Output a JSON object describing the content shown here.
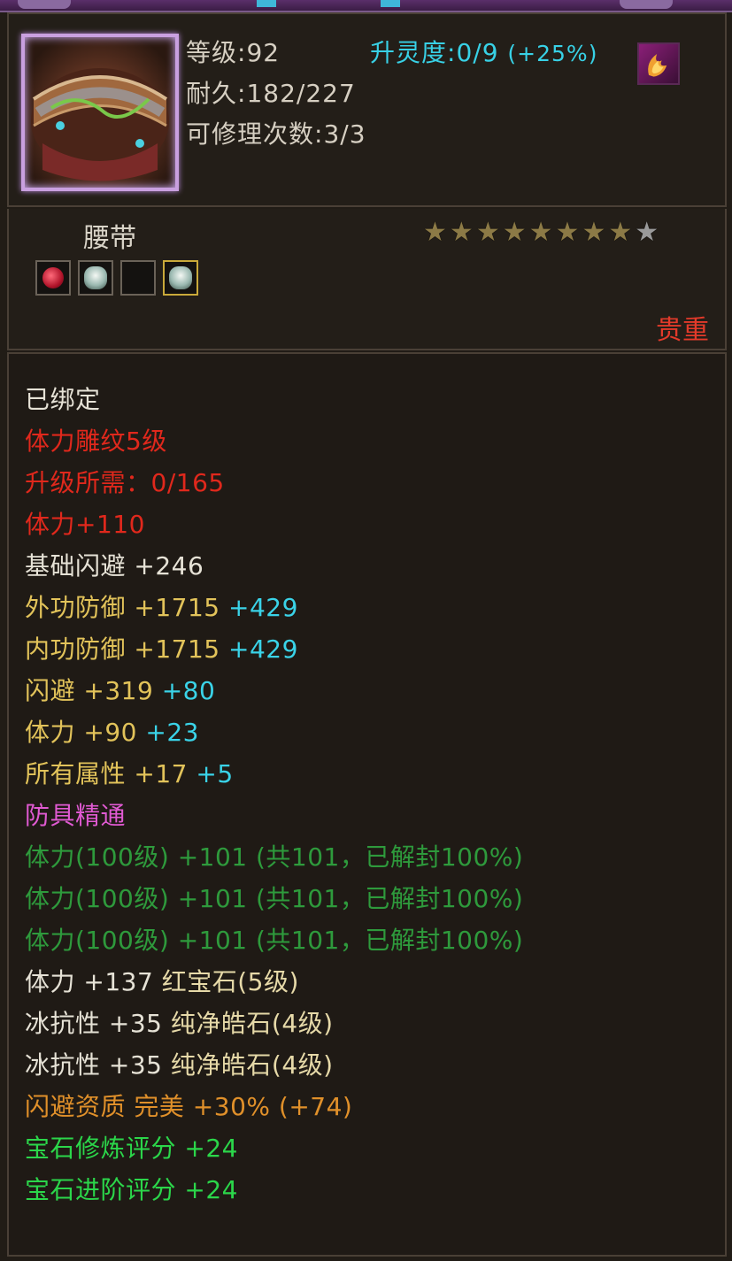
{
  "header": {
    "level_label": "等级",
    "level_value": ":92",
    "soul_label": "升灵度",
    "soul_value": ":0/9",
    "soul_bonus": "(+25%)",
    "durability_label": "耐久",
    "durability_value": ":182/227",
    "repair_label": "可修理次数",
    "repair_value": ":3/3"
  },
  "item": {
    "name": "腰带",
    "stars_filled": 8,
    "stars_total": 9,
    "quality": "贵重",
    "sockets": [
      "red-gem",
      "white-gem",
      "empty",
      "white-gem"
    ]
  },
  "attributes": [
    {
      "text": "已绑定",
      "color": "white"
    },
    {
      "text": "体力雕纹5级",
      "color": "red"
    },
    {
      "text": "升级所需：0/165",
      "color": "red"
    },
    {
      "text": "体力+110",
      "color": "red"
    },
    {
      "text": "基础闪避 +246",
      "color": "white"
    },
    {
      "text": "外功防御 +1715",
      "extra": "+429",
      "color": "yellow"
    },
    {
      "text": "内功防御 +1715",
      "extra": "+429",
      "color": "yellow"
    },
    {
      "text": "闪避 +319",
      "extra": "+80",
      "color": "yellow"
    },
    {
      "text": "体力 +90",
      "extra": "+23",
      "color": "yellow"
    },
    {
      "text": "所有属性 +17",
      "extra": "+5",
      "color": "yellow"
    },
    {
      "text": "防具精通",
      "color": "pink"
    },
    {
      "text": "体力(100级) +101 (共101，已解封100%)",
      "color": "green"
    },
    {
      "text": "体力(100级) +101 (共101，已解封100%)",
      "color": "green"
    },
    {
      "text": "体力(100级) +101 (共101，已解封100%)",
      "color": "green"
    },
    {
      "text": "体力 +137",
      "gem": "红宝石(5级)",
      "color": "white"
    },
    {
      "text": "冰抗性 +35",
      "gem": "纯净皓石(4级)",
      "color": "white"
    },
    {
      "text": "冰抗性 +35",
      "gem": "纯净皓石(4级)",
      "color": "white"
    },
    {
      "text": "闪避资质  完美 +30% (+74)",
      "color": "orange"
    },
    {
      "text": "宝石修炼评分 +24",
      "color": "bright"
    },
    {
      "text": "宝石进阶评分 +24",
      "color": "bright"
    }
  ],
  "colors": {
    "white": "#e6e2d6",
    "red": "#e0281c",
    "yellow": "#e2c35a",
    "pink": "#e05ad2",
    "green": "#2e9a3c",
    "bright": "#2bd64a",
    "orange": "#e0902a",
    "cyan": "#3ad3e8"
  }
}
